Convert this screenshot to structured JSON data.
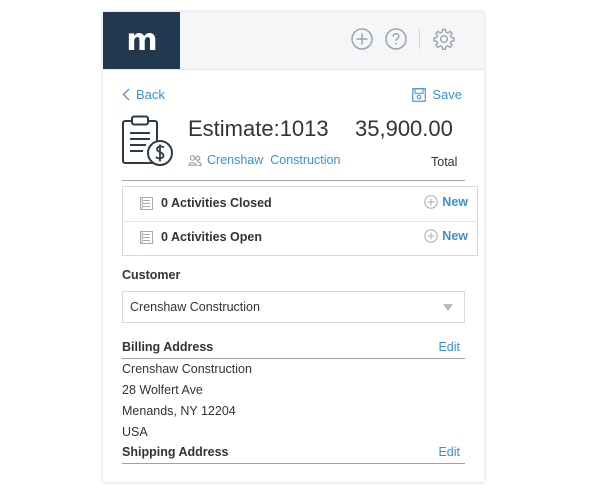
{
  "topbar": {
    "logo_text": "m",
    "icons": [
      "plus-circle-icon",
      "help-circle-icon",
      "gear-icon"
    ]
  },
  "nav": {
    "back_label": "Back",
    "save_label": "Save"
  },
  "estimate": {
    "title": "Estimate:1013",
    "amount": "35,900.00",
    "total_label": "Total",
    "company_link": "Crenshaw  Construction"
  },
  "activities": [
    {
      "label": "0 Activities Closed",
      "action": "New"
    },
    {
      "label": "0 Activities Open",
      "action": "New"
    }
  ],
  "customer": {
    "label": "Customer",
    "selected": "Crenshaw Construction"
  },
  "billing": {
    "label": "Billing Address",
    "edit_label": "Edit",
    "lines": [
      "Crenshaw Construction",
      "28 Wolfert Ave",
      "Menands, NY 12204",
      "USA"
    ]
  },
  "shipping": {
    "label": "Shipping Address",
    "edit_label": "Edit"
  },
  "colors": {
    "brand": "#22384f",
    "link": "#3f8fcc",
    "text": "#333333"
  }
}
